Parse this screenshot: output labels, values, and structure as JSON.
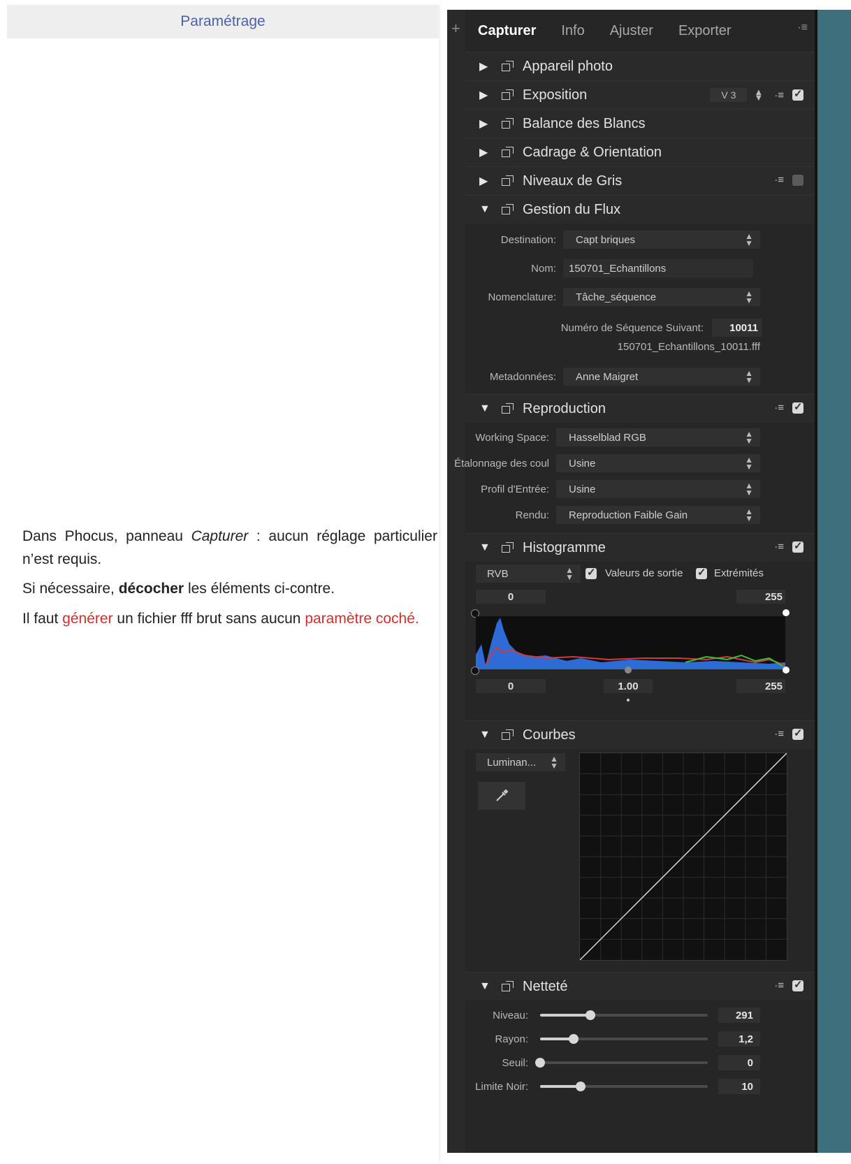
{
  "doc": {
    "header": "Paramétrage",
    "p1_a": "Dans Phocus, panneau ",
    "p1_em": "Capturer",
    "p1_b": " :   aucun réglage particulier n’est requis.",
    "p2_a": "Si nécessaire, ",
    "p2_strong": "décocher",
    "p2_b": " les éléments ci-contre.",
    "p3_a": "Il faut ",
    "p3_red1": "générer",
    "p3_b": " un fichier fff brut sans aucun ",
    "p3_red2": "paramètre coché."
  },
  "panel": {
    "plus": "+",
    "tabs": [
      "Capturer",
      "Info",
      "Ajuster",
      "Exporter"
    ],
    "menu_icon": "·≡",
    "sections": {
      "appareil": "Appareil photo",
      "exposition": "Exposition",
      "exposition_version": "V 3",
      "balance": "Balance des Blancs",
      "cadrage": "Cadrage & Orientation",
      "niveaux": "Niveaux de Gris",
      "flux": "Gestion du Flux",
      "reproduction": "Reproduction",
      "histogramme": "Histogramme",
      "courbes": "Courbes",
      "nettete": "Netteté"
    },
    "flux": {
      "destination_label": "Destination:",
      "destination_value": "Capt briques",
      "nom_label": "Nom:",
      "nom_value": "150701_Echantillons",
      "nomenclature_label": "Nomenclature:",
      "nomenclature_value": "Tâche_séquence",
      "sequence_label": "Numéro de Séquence Suivant:",
      "sequence_value": "10011",
      "filename": "150701_Echantillons_10011.fff",
      "meta_label": "Metadonnées:",
      "meta_value": "Anne Maigret"
    },
    "reproduction": {
      "ws_label": "Working Space:",
      "ws_value": "Hasselblad RGB",
      "etal_label": "Étalonnage des coul",
      "etal_value": "Usine",
      "profil_label": "Profil d'Entrée:",
      "profil_value": "Usine",
      "rendu_label": "Rendu:",
      "rendu_value": "Reproduction Faible Gain"
    },
    "histogramme": {
      "channel": "RVB",
      "valeurs": "Valeurs de sortie",
      "extremites": "Extrémités",
      "in_min": "0",
      "in_max": "255",
      "out_min": "0",
      "gamma": "1.00",
      "out_max": "255"
    },
    "courbes": {
      "channel": "Luminan..."
    },
    "nettete": {
      "niveau_label": "Niveau:",
      "niveau_value": "291",
      "niveau_level": 0.3,
      "rayon_label": "Rayon:",
      "rayon_value": "1,2",
      "rayon_level": 0.2,
      "seuil_label": "Seuil:",
      "seuil_value": "0",
      "seuil_level": 0.0,
      "noir_label": "Limite Noir:",
      "noir_value": "10",
      "noir_level": 0.24
    }
  }
}
